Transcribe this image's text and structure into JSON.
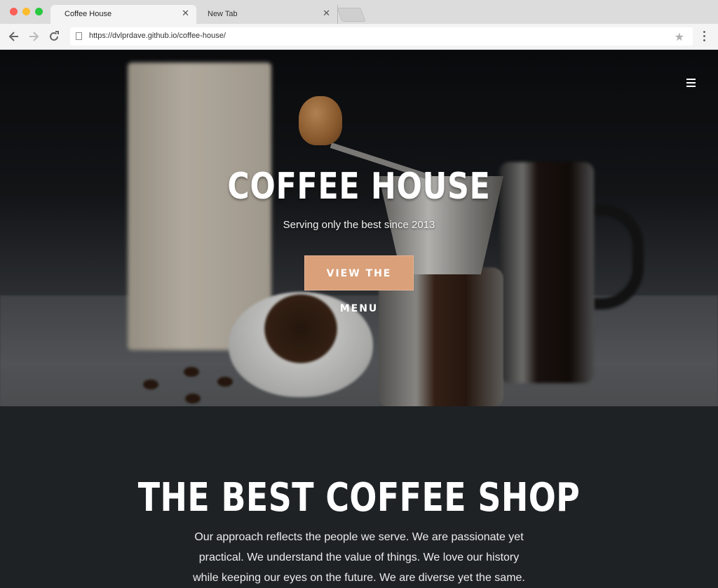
{
  "browser": {
    "tabs": [
      {
        "title": "Coffee House",
        "active": true
      },
      {
        "title": "New Tab",
        "active": false
      }
    ],
    "url": "https://dvlprdave.github.io/coffee-house/",
    "icons": {
      "back": "arrow-left-icon",
      "forward": "arrow-right-icon",
      "reload": "reload-icon",
      "bookmark": "star-icon",
      "menu": "vertical-dots-icon",
      "close": "close-icon"
    }
  },
  "hero": {
    "title": "COFFEE HOUSE",
    "subtitle": "Serving only the best since 2013",
    "cta_label": "VIEW THE MENU",
    "cta_color": "#d9a07a",
    "menu_icon": "hamburger-icon"
  },
  "about": {
    "title": "THE BEST COFFEE SHOP",
    "lines": [
      "Our approach reflects the people we serve. We are passionate yet",
      "practical. We understand the value of things. We love our history",
      "while keeping our eyes on the future. We are diverse yet the same."
    ],
    "background": "#1f2225"
  }
}
